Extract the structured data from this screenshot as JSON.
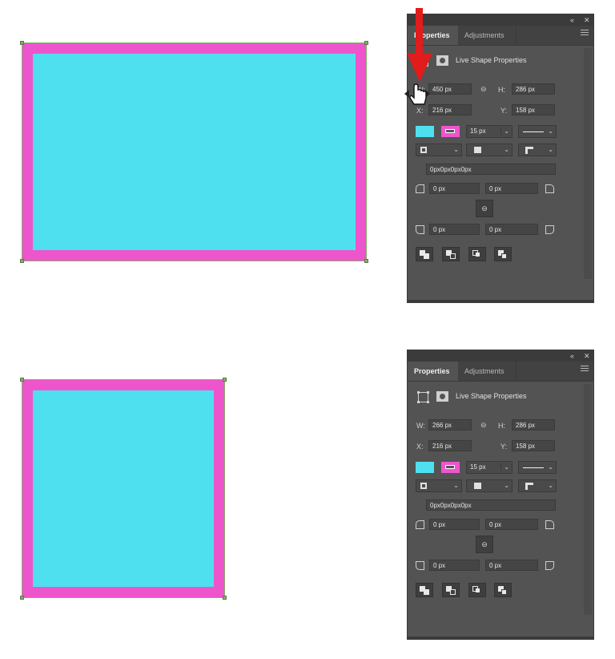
{
  "colors": {
    "fill": "#4fe0ef",
    "stroke": "#ee55cd",
    "panel_bg": "#535353",
    "arrow": "#e21b1b"
  },
  "panel_top": {
    "collapse_icon": "double-chevron-icon",
    "close_icon": "close-icon",
    "tab_properties": "Properties",
    "tab_adjustments": "Adjustments",
    "section_title": "Live Shape Properties",
    "w_label": "W:",
    "w_value": "450 px",
    "h_label": "H:",
    "h_value": "286 px",
    "x_label": "X:",
    "x_value": "216 px",
    "y_label": "Y:",
    "y_value": "158 px",
    "stroke_width": "15 px",
    "corner_text": "0px0px0px0px",
    "tl": "0 px",
    "tr": "0 px",
    "bl": "0 px",
    "br": "0 px"
  },
  "panel_bottom": {
    "collapse_icon": "double-chevron-icon",
    "close_icon": "close-icon",
    "tab_properties": "Properties",
    "tab_adjustments": "Adjustments",
    "section_title": "Live Shape Properties",
    "w_label": "W:",
    "w_value": "266 px",
    "h_label": "H:",
    "h_value": "286 px",
    "x_label": "X:",
    "x_value": "216 px",
    "y_label": "Y:",
    "y_value": "158 px",
    "stroke_width": "15 px",
    "corner_text": "0px0px0px0px",
    "tl": "0 px",
    "tr": "0 px",
    "bl": "0 px",
    "br": "0 px"
  }
}
